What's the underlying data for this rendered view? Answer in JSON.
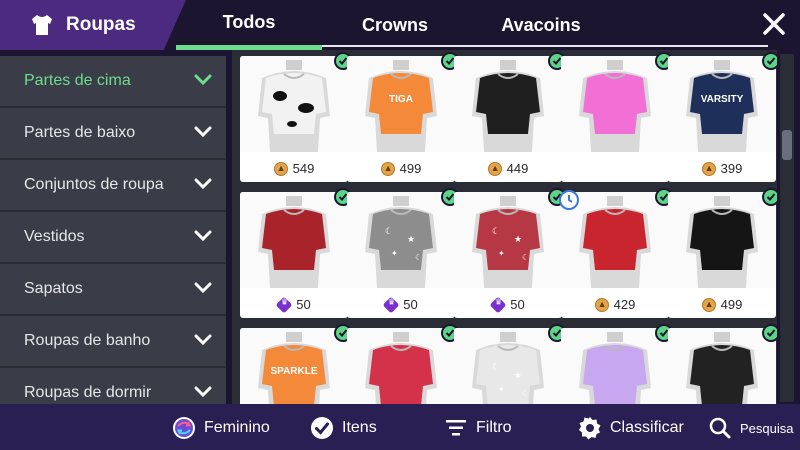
{
  "header": {
    "title": "Roupas",
    "tabs": [
      {
        "label": "Todos",
        "active": true
      },
      {
        "label": "Crowns",
        "active": false
      },
      {
        "label": "Avacoins",
        "active": false
      }
    ]
  },
  "sidebar": {
    "items": [
      {
        "label": "Partes de cima",
        "active": true
      },
      {
        "label": "Partes de baixo",
        "active": false
      },
      {
        "label": "Conjuntos de roupa",
        "active": false
      },
      {
        "label": "Vestidos",
        "active": false
      },
      {
        "label": "Sapatos",
        "active": false
      },
      {
        "label": "Roupas de banho",
        "active": false
      },
      {
        "label": "Roupas de dormir",
        "active": false
      }
    ]
  },
  "grid": {
    "items": [
      {
        "price": "549",
        "currency": "avacoin",
        "owned": true,
        "timed": false,
        "shirt": "#f2f2f2",
        "pattern": "cow"
      },
      {
        "price": "499",
        "currency": "avacoin",
        "owned": true,
        "timed": false,
        "shirt": "#f4893a",
        "pattern": "text",
        "text": "TIGA"
      },
      {
        "price": "449",
        "currency": "avacoin",
        "owned": true,
        "timed": false,
        "shirt": "#1f1f1f",
        "pattern": "none"
      },
      {
        "price": "",
        "currency": "none",
        "owned": true,
        "timed": false,
        "shirt": "#f26fd6",
        "pattern": "none"
      },
      {
        "price": "399",
        "currency": "avacoin",
        "owned": true,
        "timed": false,
        "shirt": "#1e2f5a",
        "pattern": "text",
        "text": "VARSITY"
      },
      {
        "price": "50",
        "currency": "crown",
        "owned": true,
        "timed": false,
        "shirt": "#a8232a",
        "pattern": "none"
      },
      {
        "price": "50",
        "currency": "crown",
        "owned": true,
        "timed": false,
        "shirt": "#8d8d8d",
        "pattern": "stars"
      },
      {
        "price": "50",
        "currency": "crown",
        "owned": true,
        "timed": false,
        "shirt": "#b73845",
        "pattern": "stars"
      },
      {
        "price": "429",
        "currency": "avacoin",
        "owned": true,
        "timed": true,
        "shirt": "#c8252f",
        "pattern": "none"
      },
      {
        "price": "499",
        "currency": "avacoin",
        "owned": true,
        "timed": false,
        "shirt": "#151515",
        "pattern": "none"
      },
      {
        "price": "",
        "currency": "none",
        "owned": true,
        "timed": false,
        "shirt": "#f4893a",
        "pattern": "text",
        "text": "SPARKLE"
      },
      {
        "price": "",
        "currency": "none",
        "owned": true,
        "timed": false,
        "shirt": "#d4324a",
        "pattern": "none"
      },
      {
        "price": "",
        "currency": "none",
        "owned": true,
        "timed": false,
        "shirt": "#e8e8e8",
        "pattern": "stars"
      },
      {
        "price": "",
        "currency": "none",
        "owned": true,
        "timed": false,
        "shirt": "#c7a7f0",
        "pattern": "none"
      },
      {
        "price": "",
        "currency": "none",
        "owned": true,
        "timed": false,
        "shirt": "#222222",
        "pattern": "none"
      }
    ]
  },
  "bottom": {
    "gender_label": "Feminino",
    "items_label": "Itens",
    "filter_label": "Filtro",
    "sort_label": "Classificar",
    "search_label": "Pesquisa"
  },
  "colors": {
    "accent_green": "#6edc8c",
    "title_purple": "#4b2a80",
    "bottom_purple": "#2a1f53",
    "sidebar_gray": "#3a3d47"
  }
}
